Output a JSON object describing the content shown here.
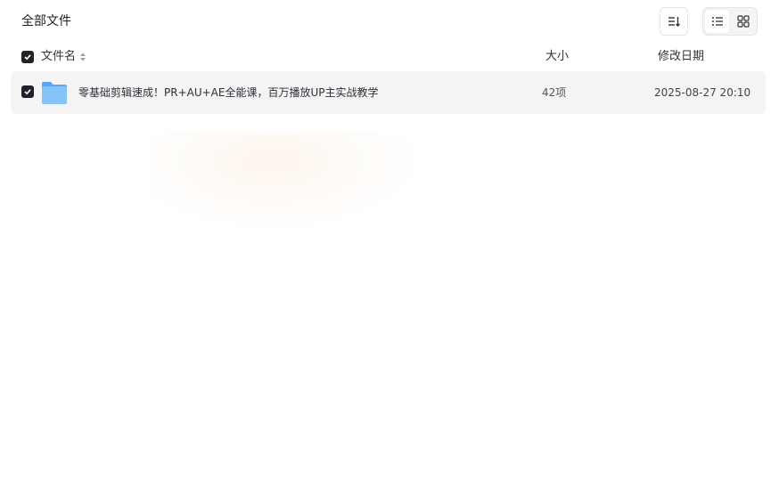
{
  "breadcrumb": {
    "label": "全部文件"
  },
  "toolbar": {
    "sort_icon": "sort-icon",
    "view_list_icon": "list-view-icon",
    "view_grid_icon": "grid-view-icon",
    "active_view": "list"
  },
  "table": {
    "columns": {
      "name": "文件名",
      "size": "大小",
      "date": "修改日期"
    },
    "select_all_checked": true,
    "rows": [
      {
        "checked": true,
        "icon": "folder-icon",
        "name": "零基础剪辑速成！PR+AU+AE全能课，百万播放UP主实战教学",
        "size": "42项",
        "date": "2025-08-27 20:10"
      }
    ]
  },
  "colors": {
    "checkbox": "#1f2329",
    "row_bg": "#f4f4f5",
    "folder": "#6fb6f5"
  }
}
